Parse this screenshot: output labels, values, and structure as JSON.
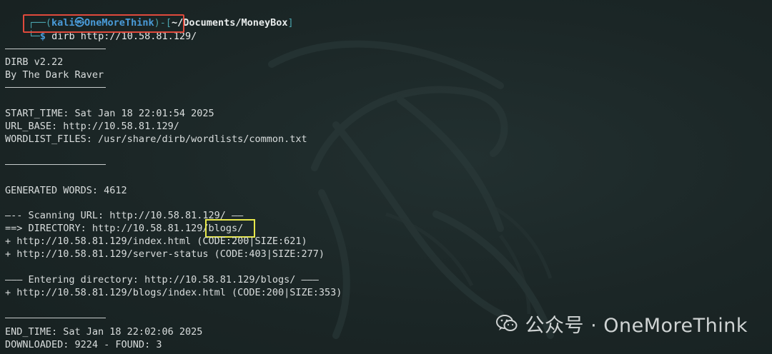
{
  "prompt": {
    "top_prefix": "┌──(",
    "user_host": "kali㉿OneMoreThink",
    "mid": ")-[",
    "path": "~/Documents/MoneyBox",
    "end": "]",
    "second_prefix": "└─",
    "dollar": "$",
    "command": "dirb http://10.58.81.129/"
  },
  "output": {
    "banner_name": "DIRB v2.22",
    "banner_author": "By The Dark Raver",
    "start_time": "START_TIME: Sat Jan 18 22:01:54 2025",
    "url_base": "URL_BASE: http://10.58.81.129/",
    "wordlist": "WORDLIST_FILES: /usr/share/dirb/wordlists/common.txt",
    "generated_words": "GENERATED WORDS: 4612",
    "scanning": "—-- Scanning URL: http://10.58.81.129/ ——",
    "directory": "==> DIRECTORY: http://10.58.81.129/blogs/",
    "hit1": "+ http://10.58.81.129/index.html (CODE:200|SIZE:621)",
    "hit2": "+ http://10.58.81.129/server-status (CODE:403|SIZE:277)",
    "entering": "——— Entering directory: http://10.58.81.129/blogs/ ———",
    "hit3": "+ http://10.58.81.129/blogs/index.html (CODE:200|SIZE:353)",
    "end_time": "END_TIME: Sat Jan 18 22:02:06 2025",
    "summary": "DOWNLOADED: 9224 - FOUND: 3"
  },
  "watermark": {
    "text": "公众号 · OneMoreThink",
    "icon": "wechat-icon"
  },
  "colors": {
    "background": "#1d2828",
    "prompt_blue": "#4a9bd9",
    "highlight_red": "#e04a3c",
    "highlight_yellow": "#e8e84a"
  }
}
